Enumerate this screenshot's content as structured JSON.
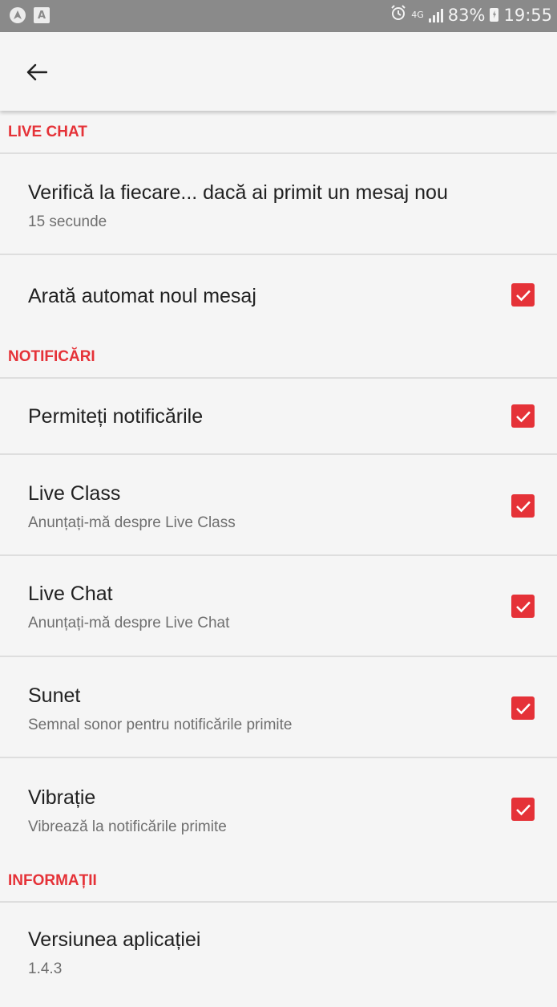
{
  "status_bar": {
    "battery": "83%",
    "time": "19:55",
    "network": "4G",
    "left_icons": [
      "location-icon",
      "image-notification-icon"
    ],
    "right_icons": [
      "alarm-icon",
      "network-4g-icon",
      "signal-icon",
      "battery-charging-icon"
    ]
  },
  "toolbar": {
    "back_icon": "arrow-left-icon"
  },
  "sections": {
    "live_chat": {
      "header": "LIVE CHAT",
      "refresh": {
        "title": "Verifică la fiecare... dacă ai primit un mesaj nou",
        "value": "15 secunde"
      },
      "auto_show": {
        "title": "Arată automat noul mesaj",
        "checked": true
      }
    },
    "notifications": {
      "header": "NOTIFICĂRI",
      "allow": {
        "title": "Permiteți notificările",
        "checked": true
      },
      "live_class": {
        "title": "Live Class",
        "subtitle": "Anunțați-mă despre Live Class",
        "checked": true
      },
      "live_chat": {
        "title": "Live Chat",
        "subtitle": "Anunțați-mă despre Live Chat",
        "checked": true
      },
      "sound": {
        "title": "Sunet",
        "subtitle": "Semnal sonor pentru notificările primite",
        "checked": true
      },
      "vibration": {
        "title": "Vibrație",
        "subtitle": "Vibrează la notificările primite",
        "checked": true
      }
    },
    "info": {
      "header": "INFORMAȚII",
      "version": {
        "title": "Versiunea aplicației",
        "value": "1.4.3"
      }
    }
  },
  "colors": {
    "accent": "#e53238",
    "background": "#f5f5f5",
    "status_bar": "#8a8a8a",
    "divider": "#dedede"
  }
}
